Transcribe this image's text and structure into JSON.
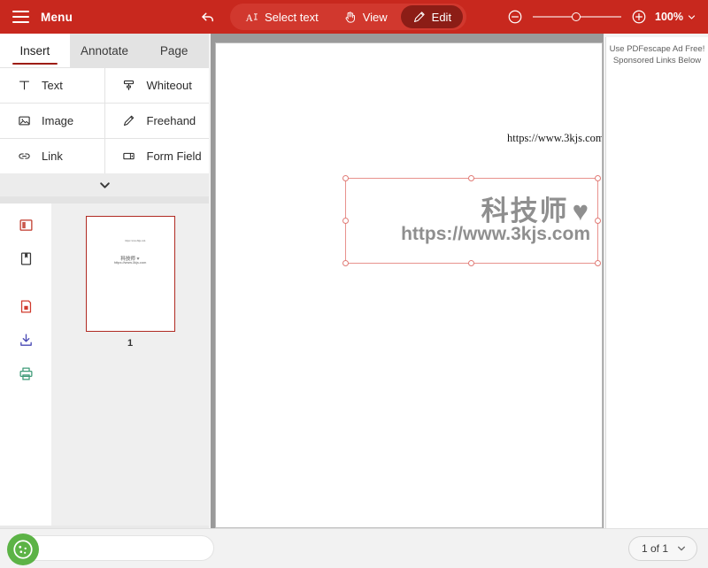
{
  "toolbar": {
    "menu_label": "Menu",
    "undo_icon": "undo-arrow-icon",
    "modes": [
      {
        "label": "Select text",
        "icon": "select-text-icon",
        "active": false
      },
      {
        "label": "View",
        "icon": "hand-icon",
        "active": false
      },
      {
        "label": "Edit",
        "icon": "pencil-icon",
        "active": true
      }
    ],
    "zoom_out_icon": "minus-circle-icon",
    "zoom_in_icon": "plus-circle-icon",
    "zoom_value": "100%",
    "zoom_chevron": "chevron-down-icon",
    "bg_color": "#c8281e",
    "active_mode_color": "#8c1d16"
  },
  "sidebar": {
    "tabs": [
      {
        "label": "Insert",
        "active": true
      },
      {
        "label": "Annotate",
        "active": false
      },
      {
        "label": "Page",
        "active": false
      }
    ],
    "tools": [
      {
        "label": "Text",
        "icon": "text-icon"
      },
      {
        "label": "Whiteout",
        "icon": "whiteout-icon"
      },
      {
        "label": "Image",
        "icon": "image-icon"
      },
      {
        "label": "Freehand",
        "icon": "freehand-pencil-icon"
      },
      {
        "label": "Link",
        "icon": "link-icon"
      },
      {
        "label": "Form Field",
        "icon": "form-field-icon"
      }
    ],
    "expander_icon": "chevron-down-icon",
    "rail": [
      {
        "icon": "page-layout-icon",
        "color": "#c0392b",
        "active": false
      },
      {
        "icon": "bookmark-page-icon",
        "color": "#3a3a3a",
        "active": true
      },
      {
        "icon": "save-document-icon",
        "color": "#d03b2e",
        "active": false
      },
      {
        "icon": "download-icon",
        "color": "#4a4ab5",
        "active": false
      },
      {
        "icon": "print-icon",
        "color": "#3f9b78",
        "active": false
      }
    ],
    "thumbnail": {
      "page_number": "1",
      "preview_header": "https://www.3kjs.com",
      "preview_logo": "科技师 ♥",
      "preview_url": "https://www.3kjs.com",
      "border_color": "#b02a22"
    }
  },
  "document": {
    "header_text": "https://www.3kjs.com",
    "selected_object": {
      "cjk_text": "科技师",
      "heart_glyph": "♥",
      "url_text": "https://www.3kjs.com",
      "selected": true,
      "handle_count": 8,
      "selection_color": "#e8928d"
    }
  },
  "ad_panel": {
    "line1": "Use PDFescape Ad Free!",
    "line2": "Sponsored Links Below"
  },
  "bottom": {
    "search_placeholder": "",
    "search_value": "",
    "cookie_icon": "cookie-consent-icon",
    "page_indicator": "1 of 1",
    "page_chevron": "chevron-down-icon"
  }
}
